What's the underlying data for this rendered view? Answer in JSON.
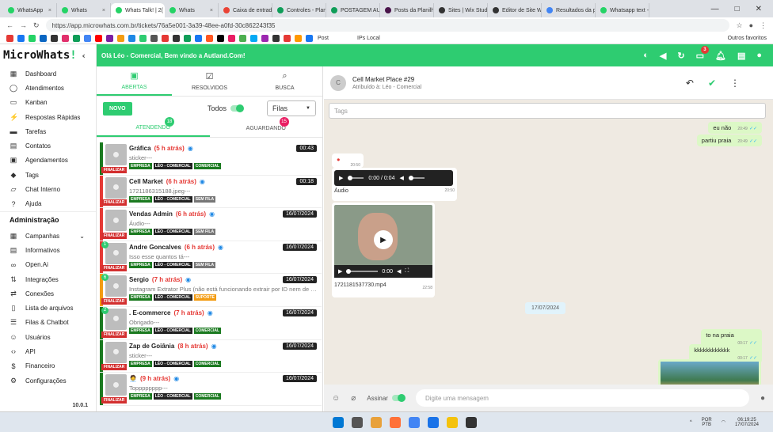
{
  "browser": {
    "tabs": [
      {
        "label": "WhatsApp",
        "color": "#25d366"
      },
      {
        "label": "Whats",
        "color": "#25d366"
      },
      {
        "label": "Whats Talk! | 2(",
        "color": "#25d366",
        "active": true
      },
      {
        "label": "Whats",
        "color": "#25d366"
      },
      {
        "label": "Caixa de entrada",
        "color": "#ea4335"
      },
      {
        "label": "Controles - Planil",
        "color": "#0f9d58"
      },
      {
        "label": "POSTAGEM AUTO",
        "color": "#0f9d58"
      },
      {
        "label": "Posts da Planilha",
        "color": "#4a154b"
      },
      {
        "label": "Sites | Wix Studio",
        "color": "#333"
      },
      {
        "label": "Editor de Site Wix",
        "color": "#333"
      },
      {
        "label": "Resultados da pe",
        "color": "#4285f4"
      },
      {
        "label": "Whatsapp text -",
        "color": "#25d366"
      }
    ],
    "url": "https://app.microwhats.com.br/tickets/76a5e001-3a39-48ee-a0fd-30c862243f35",
    "bookmark_labels": {
      "post": "Post",
      "iplocal": "IPs Local",
      "outros": "Outros favoritos"
    }
  },
  "sidebar": {
    "logo": "MicroWhats",
    "logo_mark": "!",
    "items": [
      {
        "label": "Dashboard",
        "icon": "grid-icon",
        "glyph": "▦"
      },
      {
        "label": "Atendimentos",
        "icon": "whatsapp-icon",
        "glyph": "◯"
      },
      {
        "label": "Kanban",
        "icon": "kanban-icon",
        "glyph": "▭"
      },
      {
        "label": "Respostas Rápidas",
        "icon": "bolt-icon",
        "glyph": "⚡"
      },
      {
        "label": "Tarefas",
        "icon": "tasks-icon",
        "glyph": "▬"
      },
      {
        "label": "Contatos",
        "icon": "contacts-icon",
        "glyph": "▤"
      },
      {
        "label": "Agendamentos",
        "icon": "calendar-icon",
        "glyph": "▣"
      },
      {
        "label": "Tags",
        "icon": "tag-icon",
        "glyph": "◆"
      },
      {
        "label": "Chat Interno",
        "icon": "chat-icon",
        "glyph": "▱"
      },
      {
        "label": "Ajuda",
        "icon": "help-icon",
        "glyph": "?"
      }
    ],
    "admin_title": "Administração",
    "admin_items": [
      {
        "label": "Campanhas",
        "icon": "campaign-icon",
        "glyph": "▦",
        "chevron": "⌄"
      },
      {
        "label": "Informativos",
        "icon": "info-icon",
        "glyph": "▤"
      },
      {
        "label": "Open.Ai",
        "icon": "openai-icon",
        "glyph": "∞"
      },
      {
        "label": "Integrações",
        "icon": "integrations-icon",
        "glyph": "⇅"
      },
      {
        "label": "Conexões",
        "icon": "connections-icon",
        "glyph": "⇄"
      },
      {
        "label": "Lista de arquivos",
        "icon": "files-icon",
        "glyph": "▯"
      },
      {
        "label": "Filas & Chatbot",
        "icon": "queue-icon",
        "glyph": "☰"
      },
      {
        "label": "Usuários",
        "icon": "users-icon",
        "glyph": "☺"
      },
      {
        "label": "API",
        "icon": "code-icon",
        "glyph": "‹›"
      },
      {
        "label": "Financeiro",
        "icon": "money-icon",
        "glyph": "$"
      },
      {
        "label": "Configurações",
        "icon": "gear-icon",
        "glyph": "⚙"
      }
    ],
    "version": "10.0.1"
  },
  "topbar": {
    "greeting": "Olá Léo - Comercial, Bem vindo a Autland.Com!",
    "chat_badge": "3"
  },
  "tickets": {
    "tabs": [
      {
        "label": "ABERTAS",
        "glyph": "▣"
      },
      {
        "label": "RESOLVIDOS",
        "glyph": "☑"
      },
      {
        "label": "BUSCA",
        "glyph": "⌕"
      }
    ],
    "new_button": "NOVO",
    "todos_label": "Todos",
    "queue_select": "Filas",
    "subtabs": [
      {
        "label": "ATENDENDO",
        "count": "18",
        "count_color": "#2ecc71"
      },
      {
        "label": "AGUARDANDO",
        "count": "15",
        "count_color": "#e91e63"
      }
    ],
    "finalizar_label": "FINALIZAR",
    "list": [
      {
        "name": "Gráfica",
        "ago": "(5 h atrás)",
        "time": "00:43",
        "msg": "sticker---",
        "tags": [
          "EMPRESA",
          "LÉO - COMERCIAL",
          "COMERCIAL"
        ],
        "bar": "#1b7a20",
        "unread": ""
      },
      {
        "name": "Cell Market",
        "ago": "(6 h atrás)",
        "time": "00:18",
        "msg": "1721186315188.jpeg---",
        "tags": [
          "EMPRESA",
          "LÉO - COMERCIAL",
          "SEM FILA"
        ],
        "bar": "#e53935",
        "unread": ""
      },
      {
        "name": "Vendas Admin",
        "ago": "(6 h atrás)",
        "time": "16/07/2024",
        "msg": "Áudio---",
        "tags": [
          "EMPRESA",
          "LÉO - COMERCIAL",
          "SEM FILA"
        ],
        "bar": "#e53935",
        "unread": ""
      },
      {
        "name": "Andre Goncalves",
        "ago": "(6 h atrás)",
        "time": "16/07/2024",
        "msg": "Isso esse quantos tá---",
        "tags": [
          "EMPRESA",
          "LÉO - COMERCIAL",
          "SEM FILA"
        ],
        "bar": "#e53935",
        "unread": "1"
      },
      {
        "name": "Sergio",
        "ago": "(7 h atrás)",
        "time": "16/07/2024",
        "msg": "Instagram Extrator Plus (não está funcionando extrair por ID nem de l...",
        "tags": [
          "EMPRESA",
          "LÉO - COMERCIAL",
          "SUPORTE"
        ],
        "bar": "#f39c12",
        "unread": "6"
      },
      {
        "name": ". E-commerce",
        "ago": "(7 h atrás)",
        "time": "16/07/2024",
        "msg": "Obrigado---",
        "tags": [
          "EMPRESA",
          "LÉO - COMERCIAL",
          "COMERCIAL"
        ],
        "bar": "#1b7a20",
        "unread": "2"
      },
      {
        "name": "Zap de Goiânia",
        "ago": "(8 h atrás)",
        "time": "16/07/2024",
        "msg": "sticker---",
        "tags": [
          "EMPRESA",
          "LÉO - COMERCIAL",
          "COMERCIAL"
        ],
        "bar": "#1b7a20",
        "unread": ""
      },
      {
        "name": "🧑‍💼",
        "ago": "(9 h atrás)",
        "time": "16/07/2024",
        "msg": "Topppppppp---",
        "tags": [
          "EMPRESA",
          "LÉO - COMERCIAL",
          "COMERCIAL"
        ],
        "bar": "#1b7a20",
        "unread": ""
      }
    ]
  },
  "chat": {
    "avatar_letter": "C",
    "title": "Cell Market Place #29",
    "subtitle": "Atribuído à: Léo - Comercial",
    "tags_placeholder": "Tags",
    "messages": {
      "m1": {
        "text": "eu não",
        "time": "20:49"
      },
      "m2": {
        "text": "partiu praia",
        "time": "20:49"
      },
      "m3_time": "20:50",
      "audio": {
        "time_display": "0:00 / 0:04",
        "caption": "Áudio",
        "time": "20:50"
      },
      "video": {
        "time_display": "0:00",
        "caption": "1721181537730.mp4",
        "time": "22:58"
      },
      "date_chip": "17/07/2024",
      "m4": {
        "text": "to na praia",
        "time": "00:17"
      },
      "m5": {
        "text": "kkkkkkkkkkkk",
        "time": "00:17"
      }
    },
    "assinar_label": "Assinar",
    "input_placeholder": "Digite uma mensagem"
  },
  "taskbar": {
    "lang": "POR",
    "layout": "PTB",
    "time": "06:19:25",
    "date": "17/07/2024"
  }
}
